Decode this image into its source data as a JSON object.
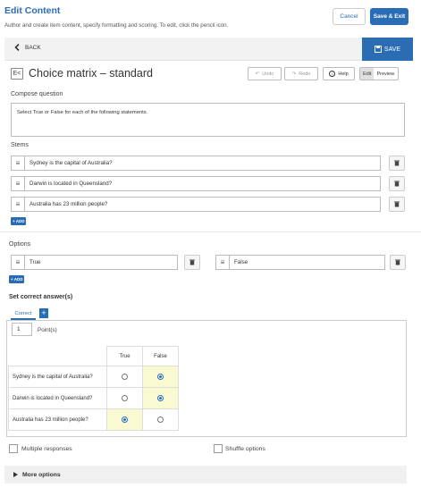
{
  "header": {
    "title": "Edit Content",
    "subtitle": "Author and create item content, specify formatting and scoring. To edit, click the pencil icon.",
    "cancel_label": "Cancel",
    "save_exit_label": "Save & Exit"
  },
  "topbar": {
    "back_label": "BACK",
    "save_label": "SAVE"
  },
  "question": {
    "type_title": "Choice matrix – standard",
    "undo_label": "Undo",
    "redo_label": "Redo",
    "help_label": "Help",
    "edit_label": "Edit",
    "preview_label": "Preview"
  },
  "compose": {
    "label": "Compose question",
    "text": "Select True or False for each of the following statements."
  },
  "stems": {
    "label": "Stems",
    "add_label": "+ ADD",
    "items": [
      "Sydney is the capital of Australia?",
      "Darwin is located in Queensland?",
      "Australia has 23 million people?"
    ]
  },
  "options": {
    "label": "Options",
    "add_label": "+ ADD",
    "items": [
      "True",
      "False"
    ]
  },
  "correct_answers": {
    "title": "Set correct answer(s)",
    "tab_label": "Correct",
    "tab_add": "+",
    "points_value": "1",
    "points_label": "Point(s)",
    "matrix_headers": [
      "True",
      "False"
    ],
    "rows": [
      {
        "stem": "Sydney is the capital of Australia?",
        "selected": "False"
      },
      {
        "stem": "Darwin is located in Queensland?",
        "selected": "False"
      },
      {
        "stem": "Australia has 23 million people?",
        "selected": "True"
      }
    ]
  },
  "settings": {
    "multiple_responses_label": "Multiple responses",
    "shuffle_options_label": "Shuffle options",
    "more_options_label": "More options"
  },
  "colors": {
    "accent": "#2a6db5",
    "selected_cell": "#fafad2"
  }
}
